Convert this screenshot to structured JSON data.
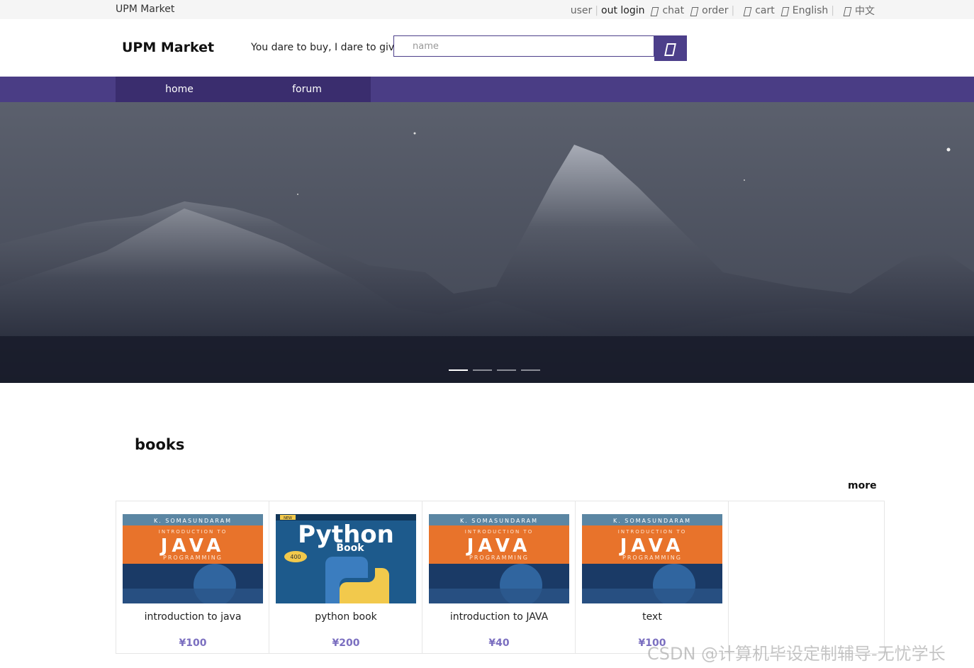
{
  "topbar": {
    "site_name": "UPM Market",
    "user": "user",
    "logout": "out login",
    "chat": "chat",
    "order": "order",
    "cart": "cart",
    "english": "English",
    "chinese": "中文"
  },
  "header": {
    "logo": "UPM Market",
    "slogan": "You dare to buy, I dare to give!",
    "search_placeholder": "name"
  },
  "nav": {
    "items": [
      {
        "label": "home"
      },
      {
        "label": "forum"
      }
    ]
  },
  "banner": {
    "slide_count": 4,
    "active_slide": 1
  },
  "books": {
    "title": "books",
    "more": "more",
    "items": [
      {
        "name": "introduction to java",
        "price": "¥100",
        "cover": "java-cover"
      },
      {
        "name": "python book",
        "price": "¥200",
        "cover": "python-cover"
      },
      {
        "name": "introduction to JAVA",
        "price": "¥40",
        "cover": "java-cover"
      },
      {
        "name": "text",
        "price": "¥100",
        "cover": "java-cover"
      }
    ]
  },
  "watermark": "CSDN @计算机毕设定制辅导-无忧学长",
  "colors": {
    "nav_bg": "#4a3d85",
    "nav_inner": "#3a2d6e",
    "price": "#7b6fc0",
    "accent": "#4c3f8a"
  }
}
